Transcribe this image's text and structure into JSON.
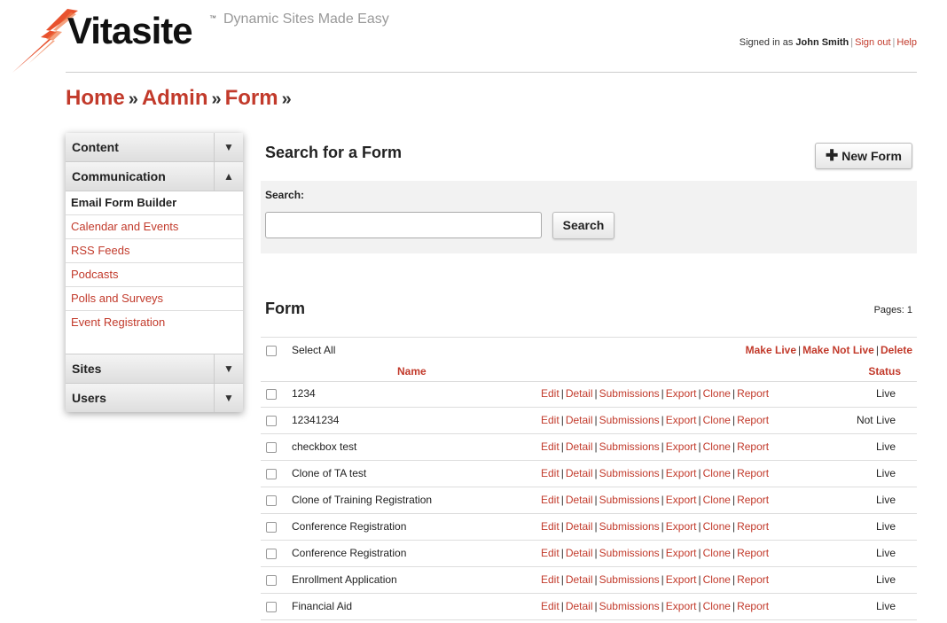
{
  "brand": {
    "name": "Vitasite",
    "trademark": "™",
    "tagline": "Dynamic Sites Made Easy",
    "accent_color": "#c23a2b",
    "bolt_color": "#e8522e"
  },
  "userbar": {
    "prefix": "Signed in as",
    "user": "John Smith",
    "sign_out": "Sign out",
    "help": "Help"
  },
  "breadcrumb": {
    "items": [
      "Home",
      "Admin",
      "Form"
    ],
    "separator": "»"
  },
  "sidebar": {
    "sections": [
      {
        "label": "Content",
        "arrow": "▼"
      },
      {
        "label": "Communication",
        "arrow": "▲"
      },
      {
        "label": "Sites",
        "arrow": "▼"
      },
      {
        "label": "Users",
        "arrow": "▼"
      }
    ],
    "communication_items": [
      "Email Form Builder",
      "Calendar and Events",
      "RSS Feeds",
      "Podcasts",
      "Polls and Surveys",
      "Event Registration"
    ]
  },
  "search": {
    "title": "Search for a Form",
    "new_button": "New Form",
    "new_icon": "plus-icon",
    "label": "Search:",
    "value": "",
    "button": "Search"
  },
  "form_list": {
    "title": "Form",
    "pages": "Pages: 1",
    "select_all": "Select All",
    "bulk_actions": [
      "Make Live",
      "Make Not Live",
      "Delete"
    ],
    "columns": {
      "name": "Name",
      "status": "Status"
    },
    "actions": [
      "Edit",
      "Detail",
      "Submissions",
      "Export",
      "Clone",
      "Report"
    ],
    "rows": [
      {
        "name": "1234",
        "status": "Live"
      },
      {
        "name": "12341234",
        "status": "Not Live"
      },
      {
        "name": "checkbox test",
        "status": "Live"
      },
      {
        "name": "Clone of TA test",
        "status": "Live"
      },
      {
        "name": "Clone of Training Registration",
        "status": "Live"
      },
      {
        "name": "Conference Registration",
        "status": "Live"
      },
      {
        "name": "Conference Registration",
        "status": "Live"
      },
      {
        "name": "Enrollment Application",
        "status": "Live"
      },
      {
        "name": "Financial Aid",
        "status": "Live"
      }
    ]
  }
}
